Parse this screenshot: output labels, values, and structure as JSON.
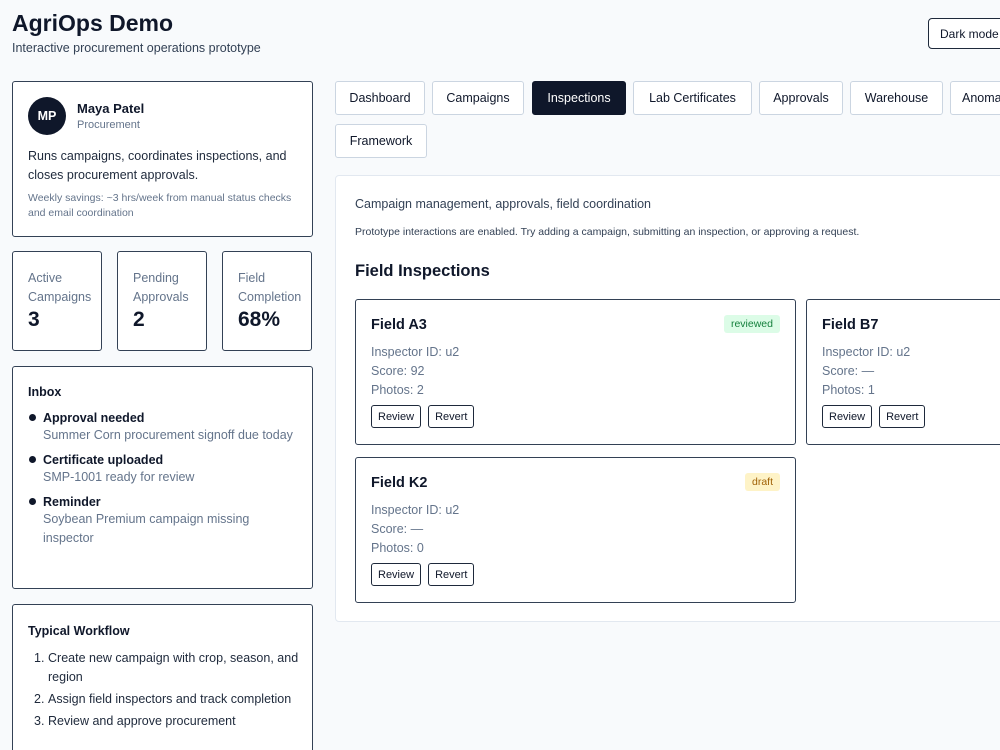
{
  "app": {
    "title": "AgriOps Demo",
    "subtitle": "Interactive procurement operations prototype",
    "dark_mode_label": "Dark mode"
  },
  "profile": {
    "initials": "MP",
    "name": "Maya Patel",
    "role": "Procurement",
    "description": "Runs campaigns, coordinates inspections, and closes procurement approvals.",
    "savings": "Weekly savings: ~3 hrs/week from manual status checks and email coordination"
  },
  "stats": [
    {
      "label": "Active Campaigns",
      "value": "3"
    },
    {
      "label": "Pending Approvals",
      "value": "2"
    },
    {
      "label": "Field Completion",
      "value": "68%"
    }
  ],
  "inbox": {
    "title": "Inbox",
    "items": [
      {
        "title": "Approval needed",
        "desc": "Summer Corn procurement signoff due today"
      },
      {
        "title": "Certificate uploaded",
        "desc": "SMP-1001 ready for review"
      },
      {
        "title": "Reminder",
        "desc": "Soybean Premium campaign missing inspector"
      }
    ]
  },
  "workflow": {
    "title": "Typical Workflow",
    "steps": [
      {
        "num": "1.",
        "text": "Create new campaign with crop, season, and region"
      },
      {
        "num": "2.",
        "text": "Assign field inspectors and track completion"
      },
      {
        "num": "3.",
        "text": "Review and approve procurement"
      }
    ]
  },
  "tabs": [
    {
      "label": "Dashboard"
    },
    {
      "label": "Campaigns"
    },
    {
      "label": "Inspections"
    },
    {
      "label": "Lab Certificates"
    },
    {
      "label": "Approvals"
    },
    {
      "label": "Warehouse"
    },
    {
      "label": "Anomalies"
    },
    {
      "label": "Framework"
    }
  ],
  "active_tab": "Inspections",
  "panel": {
    "description": "Campaign management, approvals, field coordination",
    "note": "Prototype interactions are enabled. Try adding a campaign, submitting an inspection, or approving a request.",
    "title": "Field Inspections",
    "review_label": "Review",
    "revert_label": "Revert"
  },
  "inspections": [
    {
      "field": "Field A3",
      "status": "reviewed",
      "inspector": "Inspector ID: u2",
      "score": "Score: 92",
      "photos": "Photos: 2"
    },
    {
      "field": "Field B7",
      "status": "",
      "inspector": "Inspector ID: u2",
      "score": "Score: —",
      "photos": "Photos: 1"
    },
    {
      "field": "Field K2",
      "status": "draft",
      "inspector": "Inspector ID: u2",
      "score": "Score: —",
      "photos": "Photos: 0"
    }
  ],
  "colors": {
    "primary": "#0f172a",
    "muted_text": "#64748b",
    "badge_reviewed_bg": "#dcfce7",
    "badge_reviewed_text": "#15803d",
    "badge_draft_bg": "#fef3c7",
    "badge_draft_text": "#a16207"
  }
}
